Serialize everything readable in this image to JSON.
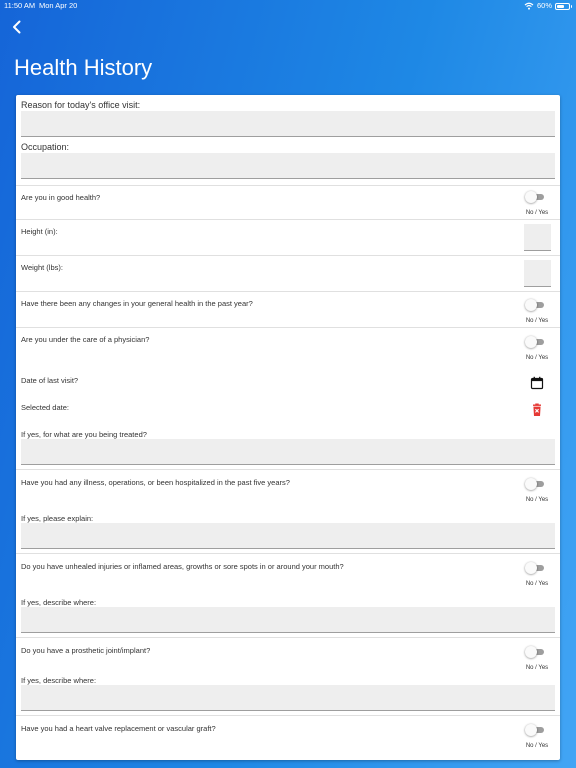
{
  "status_bar": {
    "time": "11:50 AM",
    "date": "Mon Apr 20",
    "battery": "60%",
    "battery_level": 0.6
  },
  "header": {
    "title": "Health History"
  },
  "colors": {
    "header_gradient_start": "#1565d8",
    "header_gradient_end": "#42a5f5",
    "toggle_track": "#9e9e9e",
    "delete_icon": "#e53935",
    "field_background": "#eeeeee"
  },
  "icons": {
    "back": "chevron-left-icon",
    "calendar": "calendar-icon",
    "delete": "delete-icon",
    "wifi": "wifi-icon",
    "battery": "battery-icon"
  },
  "toggle_caption": "No / Yes",
  "form": {
    "reason_label": "Reason for today's office visit:",
    "reason_value": "",
    "occupation_label": "Occupation:",
    "occupation_value": "",
    "good_health_label": "Are you in good health?",
    "height_label": "Height (in):",
    "height_value": "",
    "weight_label": "Weight (lbs):",
    "weight_value": "",
    "health_changes_label": "Have there been any changes in your general health in the past year?",
    "physician_care_label": "Are you under the care of a physician?",
    "last_visit_label": "Date of last visit?",
    "selected_date_label": "Selected date:",
    "treated_for_label": "If yes, for what are you being treated?",
    "treated_for_value": "",
    "illness_label": "Have you had any illness, operations, or been hospitalized in the past five years?",
    "illness_explain_label": "If yes, please explain:",
    "illness_explain_value": "",
    "injuries_label": "Do you have unhealed injuries or inflamed areas, growths or sore spots in or around your mouth?",
    "injuries_where_label": "If yes, describe where:",
    "injuries_where_value": "",
    "prosthetic_label": "Do you have a prosthetic joint/implant?",
    "prosthetic_where_label": "If yes, describe where:",
    "prosthetic_where_value": "",
    "heart_valve_label": "Have you had a heart valve replacement or vascular graft?"
  }
}
